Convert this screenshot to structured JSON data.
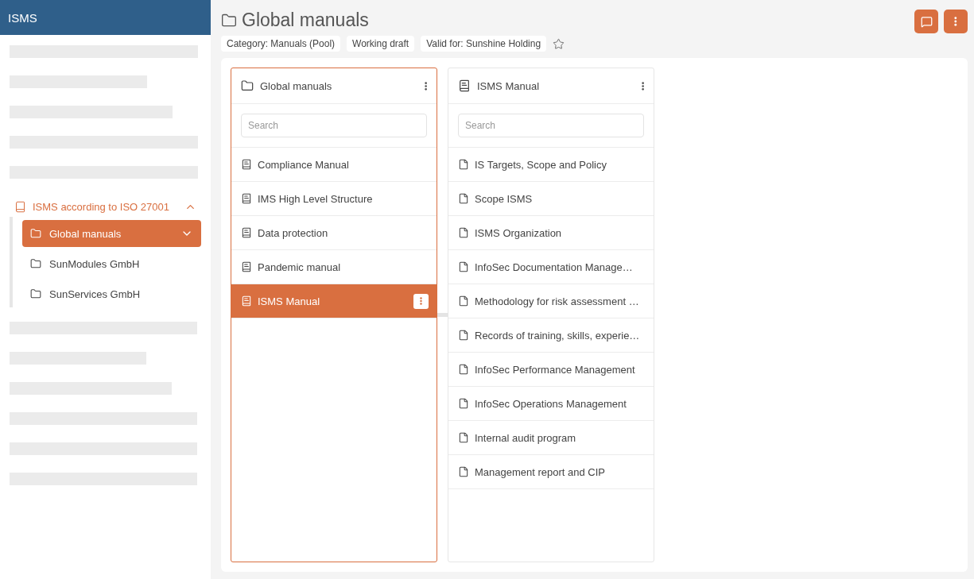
{
  "app": {
    "title": "ISMS"
  },
  "sidebar": {
    "tree": [
      {
        "label": "ISMS according to ISO 27001",
        "expanded": true,
        "children": [
          {
            "label": "Global manuals",
            "selected": true,
            "expanded": false
          },
          {
            "label": "SunModules GmbH",
            "selected": false
          },
          {
            "label": "SunServices GmbH",
            "selected": false
          }
        ]
      }
    ]
  },
  "page": {
    "title": "Global manuals",
    "tags": [
      "Category: Manuals (Pool)",
      "Working draft",
      "Valid for: Sunshine Holding"
    ],
    "favorite": false
  },
  "columns": [
    {
      "title": "Global manuals",
      "kind": "folder",
      "selected": true,
      "search_placeholder": "Search",
      "items": [
        {
          "label": "Compliance Manual",
          "kind": "manual",
          "selected": false
        },
        {
          "label": "IMS High Level Structure",
          "kind": "manual",
          "selected": false
        },
        {
          "label": "Data protection",
          "kind": "manual",
          "selected": false
        },
        {
          "label": "Pandemic manual",
          "kind": "manual",
          "selected": false
        },
        {
          "label": "ISMS Manual",
          "kind": "manual",
          "selected": true
        }
      ]
    },
    {
      "title": "ISMS Manual",
      "kind": "manual",
      "selected": false,
      "search_placeholder": "Search",
      "items": [
        {
          "label": "IS Targets, Scope and Policy",
          "kind": "document",
          "selected": false
        },
        {
          "label": "Scope ISMS",
          "kind": "document",
          "selected": false
        },
        {
          "label": "ISMS Organization",
          "kind": "document",
          "selected": false
        },
        {
          "label": "InfoSec Documentation Manage…",
          "kind": "document",
          "selected": false
        },
        {
          "label": "Methodology for risk assessment …",
          "kind": "document",
          "selected": false
        },
        {
          "label": "Records of training, skills, experie…",
          "kind": "document",
          "selected": false
        },
        {
          "label": "InfoSec Performance Management",
          "kind": "document",
          "selected": false
        },
        {
          "label": "InfoSec Operations Management",
          "kind": "document",
          "selected": false
        },
        {
          "label": "Internal audit program",
          "kind": "document",
          "selected": false
        },
        {
          "label": "Management report and CIP",
          "kind": "document",
          "selected": false
        }
      ]
    }
  ]
}
